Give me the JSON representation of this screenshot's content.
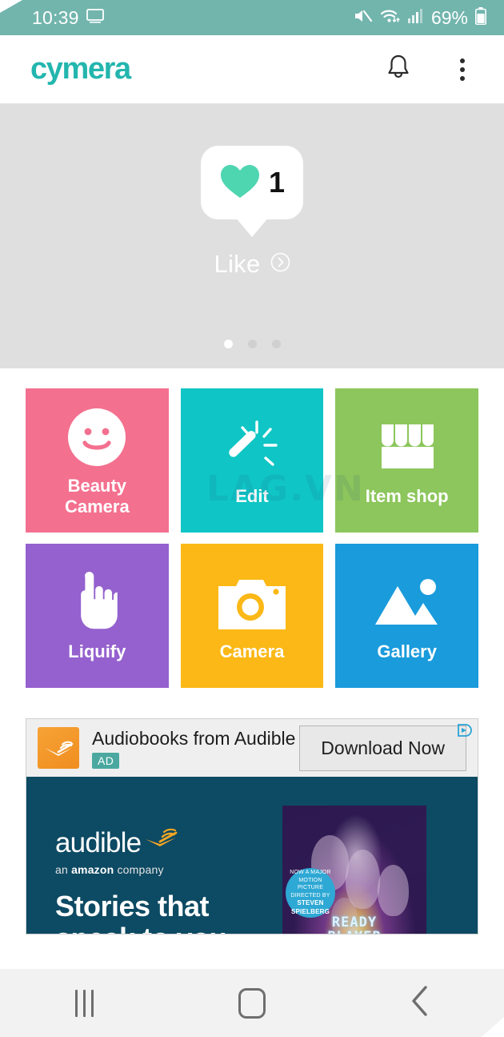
{
  "status_bar": {
    "time": "10:39",
    "battery_percent": "69%",
    "icons": [
      "screencast-icon",
      "mute-icon",
      "wifi-icon",
      "signal-icon",
      "battery-icon"
    ],
    "background_color": "#72b5ad"
  },
  "app_bar": {
    "brand": "cymera",
    "brand_color": "#23b6ae",
    "notification_label": "Notifications",
    "overflow_label": "More options"
  },
  "promo": {
    "like_count": "1",
    "like_label": "Like",
    "heart_color": "#4ed6b0",
    "background_color": "#dfdfdf",
    "pagination": {
      "total": 3,
      "active_index": 0
    }
  },
  "grid": {
    "tiles": [
      {
        "label": "Beauty\nCamera",
        "icon": "smiley-face-icon",
        "color": "#f4708f"
      },
      {
        "label": "Edit",
        "icon": "magic-wand-icon",
        "color": "#0fc5c5"
      },
      {
        "label": "Item shop",
        "icon": "storefront-icon",
        "color": "#8cc65c"
      },
      {
        "label": "Liquify",
        "icon": "pointing-hand-icon",
        "color": "#9461ce"
      },
      {
        "label": "Camera",
        "icon": "camera-icon",
        "color": "#fbb816"
      },
      {
        "label": "Gallery",
        "icon": "photo-mountain-icon",
        "color": "#1a9bdc"
      }
    ]
  },
  "watermark": {
    "text": "LAG.VN"
  },
  "ad": {
    "title": "Audiobooks from Audible",
    "badge": "AD",
    "cta": "Download Now",
    "advertiser_logo": "audible-logo-icon",
    "ad_choices": "ad-choices-icon",
    "brand_word": "audible",
    "brand_sub_prefix": "an ",
    "brand_sub_amazon": "amazon",
    "brand_sub_suffix": " company",
    "headline": "Stories that\nspeak to you",
    "poster": {
      "badge_line1": "NOW A MAJOR",
      "badge_line2": "MOTION PICTURE",
      "badge_line3": "DIRECTED BY",
      "badge_name1": "STEVEN",
      "badge_name2": "SPIELBERG",
      "title": "READY\nPLAYER\nONE"
    },
    "background_color": "#0d4a63"
  },
  "nav_bar": {
    "recents_label": "Recents",
    "home_label": "Home",
    "back_label": "Back"
  }
}
